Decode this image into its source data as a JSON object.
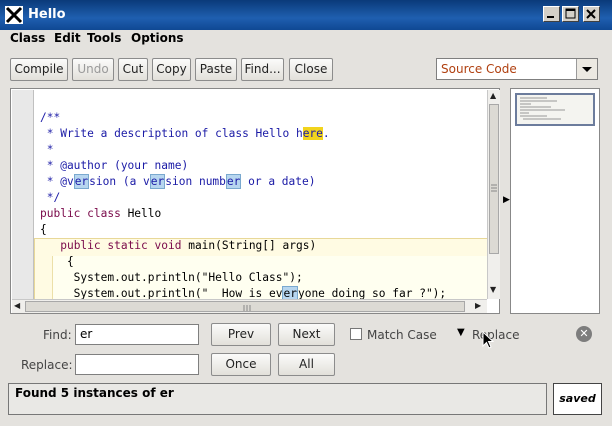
{
  "window": {
    "title": "Hello"
  },
  "menus": [
    {
      "label": "Class"
    },
    {
      "label": "Edit"
    },
    {
      "label": "Tools"
    },
    {
      "label": "Options"
    }
  ],
  "toolbar": {
    "compile": "Compile",
    "undo": "Undo",
    "cut": "Cut",
    "copy": "Copy",
    "paste": "Paste",
    "find": "Find...",
    "close": "Close"
  },
  "view_select": {
    "value": "Source Code"
  },
  "find": {
    "find_label": "Find:",
    "find_value": "er",
    "replace_label": "Replace:",
    "replace_value": "",
    "prev": "Prev",
    "next": "Next",
    "match_case": "Match Case",
    "replace_toggle": "Replace",
    "once": "Once",
    "all": "All"
  },
  "status": {
    "message": "Found 5 instances of er",
    "saved": "saved"
  },
  "colors": {
    "title_bar": "#1f5fb0",
    "search_highlight": "#b7d6ef",
    "current_match": "#f2d41d",
    "comment": "#1a1aa6",
    "keyword": "#7a0a4a"
  }
}
